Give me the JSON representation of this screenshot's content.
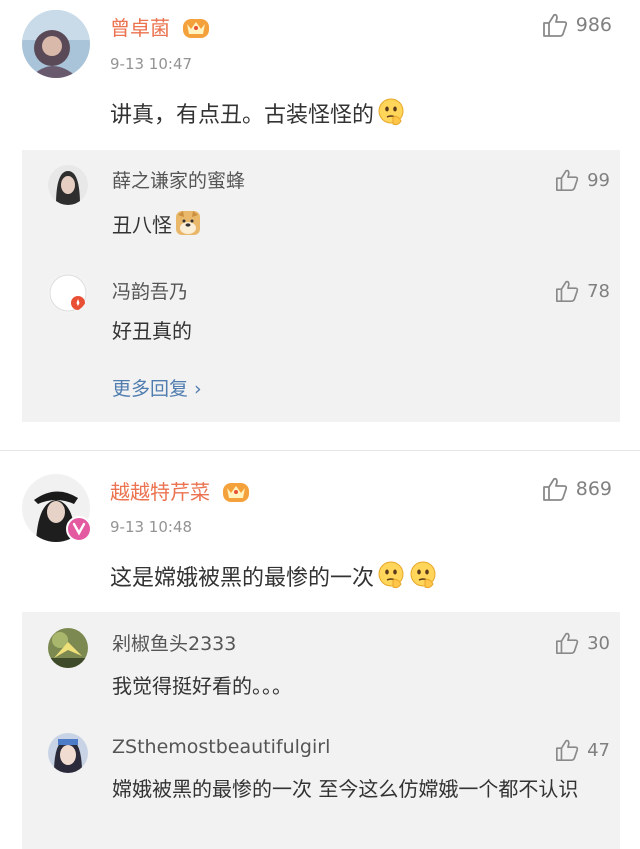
{
  "comments": [
    {
      "username": "曾卓菌",
      "timestamp": "9-13 10:47",
      "text": "讲真，有点丑。古装怪怪的",
      "likes": "986",
      "replies": [
        {
          "username": "薛之谦家的蜜蜂",
          "text": "丑八怪",
          "likes": "99"
        },
        {
          "username": "冯韵吾乃",
          "text": "好丑真的",
          "likes": "78"
        }
      ],
      "more_replies": "更多回复 ›"
    },
    {
      "username": "越越特芹菜",
      "timestamp": "9-13 10:48",
      "text": "这是嫦娥被黑的最惨的一次",
      "likes": "869",
      "replies": [
        {
          "username": "剁椒鱼头2333",
          "text": "我觉得挺好看的。。。",
          "likes": "30"
        },
        {
          "username": "ZSthemostbeautifulgirl",
          "text": "嫦娥被黑的最惨的一次 至今这么仿嫦娥一个都不认识",
          "likes": "47"
        }
      ]
    }
  ],
  "icons": {
    "like": "thumbs-up-icon",
    "vip_badge": "crown-icon",
    "emoji_thinking": "thinking-emoji-icon",
    "emoji_doge": "doge-emoji-icon"
  },
  "colors": {
    "username": "#eb7350",
    "link": "#507daf",
    "reply_bg": "#f2f2f2",
    "meta": "#939393"
  }
}
